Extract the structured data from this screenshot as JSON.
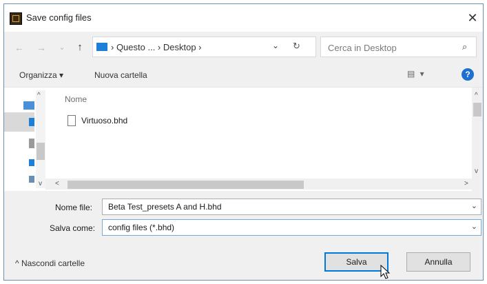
{
  "window": {
    "title": "Save config files",
    "close_glyph": "✕"
  },
  "address_bar": {
    "back_glyph": "←",
    "forward_glyph": "→",
    "recent_glyph": "⌄",
    "up_glyph": "↑",
    "path": "› Questo ... › Desktop ›",
    "dropdown_glyph": "⌄",
    "refresh_glyph": "↻"
  },
  "search": {
    "placeholder": "Cerca in Desktop",
    "icon_glyph": "⌕"
  },
  "toolbar": {
    "organize": "Organizza ▾",
    "new_folder": "Nuova cartella",
    "view_glyph": "▤ ▾",
    "help_glyph": "?"
  },
  "file_list": {
    "column_name": "Nome",
    "items": [
      {
        "name": "Virtuoso.bhd"
      }
    ]
  },
  "form": {
    "filename_label": "Nome file:",
    "filename_value": "Beta Test_presets A and H.bhd",
    "savetype_label": "Salva come:",
    "savetype_value": "config files (*.bhd)",
    "dropdown_glyph": "⌄"
  },
  "footer": {
    "hide_folders": "^  Nascondi cartelle",
    "save": "Salva",
    "cancel": "Annulla"
  },
  "colors": {
    "accent": "#0078d7",
    "folder": "#1e7fd8",
    "help": "#1e6fd0"
  }
}
